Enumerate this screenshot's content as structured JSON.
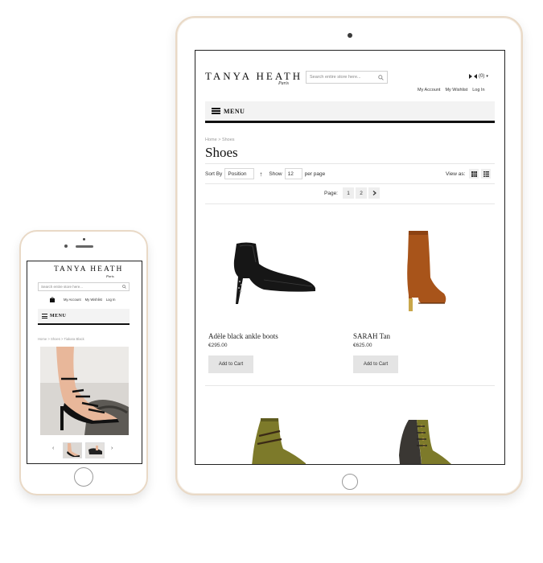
{
  "brand": {
    "name": "TANYA HEATH",
    "sub": "Paris"
  },
  "colors": {
    "accent": "#111111",
    "button_bg": "#e4e4e4",
    "menu_bg": "#f3f3f3",
    "device_frame": "#e9d9c6"
  },
  "tablet": {
    "search_placeholder": "Search entire store here...",
    "cart_count": "(0)",
    "top_links": [
      "My Account",
      "My Wishlist",
      "Log In"
    ],
    "menu_label": "MENU",
    "breadcrumb": "Home > Shoes",
    "page_title": "Shoes",
    "toolbar": {
      "sort_by_label": "Sort By",
      "sort_value": "Position",
      "show_label": "Show",
      "show_value": "12",
      "per_page_label": "per page",
      "view_as_label": "View as:"
    },
    "pager": {
      "label": "Page:",
      "pages": [
        "1",
        "2"
      ],
      "next_icon": "chevron-right-icon"
    },
    "products": [
      {
        "name": "Adèle black ankle boots",
        "price": "€295.00",
        "button": "Add to Cart"
      },
      {
        "name": "SARAH Tan",
        "price": "€625.00",
        "button": "Add to Cart"
      }
    ]
  },
  "phone": {
    "search_placeholder": "Search entire store here...",
    "top_links": [
      "My Account",
      "My Wishlist",
      "Log In"
    ],
    "menu_label": "MENU",
    "breadcrumb": "Home > Shoes > Tiakara Black",
    "prev_icon": "chevron-left-icon",
    "next_icon": "chevron-right-icon"
  }
}
